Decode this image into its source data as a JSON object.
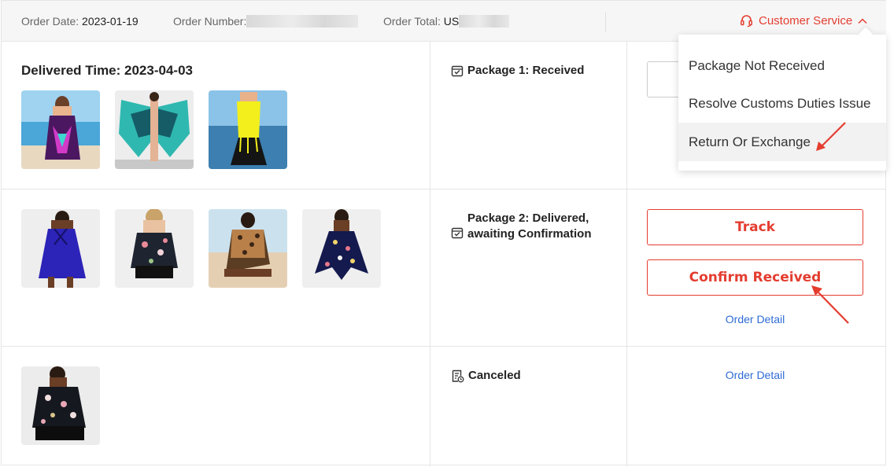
{
  "header": {
    "order_date_label": "Order Date:",
    "order_date": "2023-01-19",
    "order_number_label": "Order Number:",
    "order_total_label": "Order Total:",
    "order_total_currency": "US",
    "customer_service": "Customer Service"
  },
  "dropdown": {
    "items": [
      "Package Not Received",
      "Resolve Customs Duties Issue",
      "Return Or Exchange"
    ],
    "highlighted": "Return Or Exchange"
  },
  "packages": [
    {
      "delivered_time": "Delivered Time: 2023-04-03",
      "status": "Package 1: Received",
      "thumbs": [
        "swimdress-purple-print",
        "butterfly-coverup",
        "yellow-fringe-swimdress"
      ]
    },
    {
      "status": "Package 2: Delivered, awaiting Confirmation",
      "thumbs": [
        "blue-swimdress",
        "black-floral-tankini",
        "leopard-swimsuit",
        "navy-floral-swimdress"
      ],
      "track_label": "Track",
      "confirm_label": "Confirm Received",
      "detail_label": "Order Detail"
    },
    {
      "status": "Canceled",
      "thumbs": [
        "black-floral-tankini-plus"
      ],
      "detail_label": "Order Detail"
    }
  ],
  "colors": {
    "accent": "#e43d30",
    "link": "#2f6bd6",
    "header_bg": "#f6f6f6"
  },
  "icons": {
    "customer_service": "headset-icon",
    "package": "package-icon",
    "canceled": "receipt-icon"
  }
}
